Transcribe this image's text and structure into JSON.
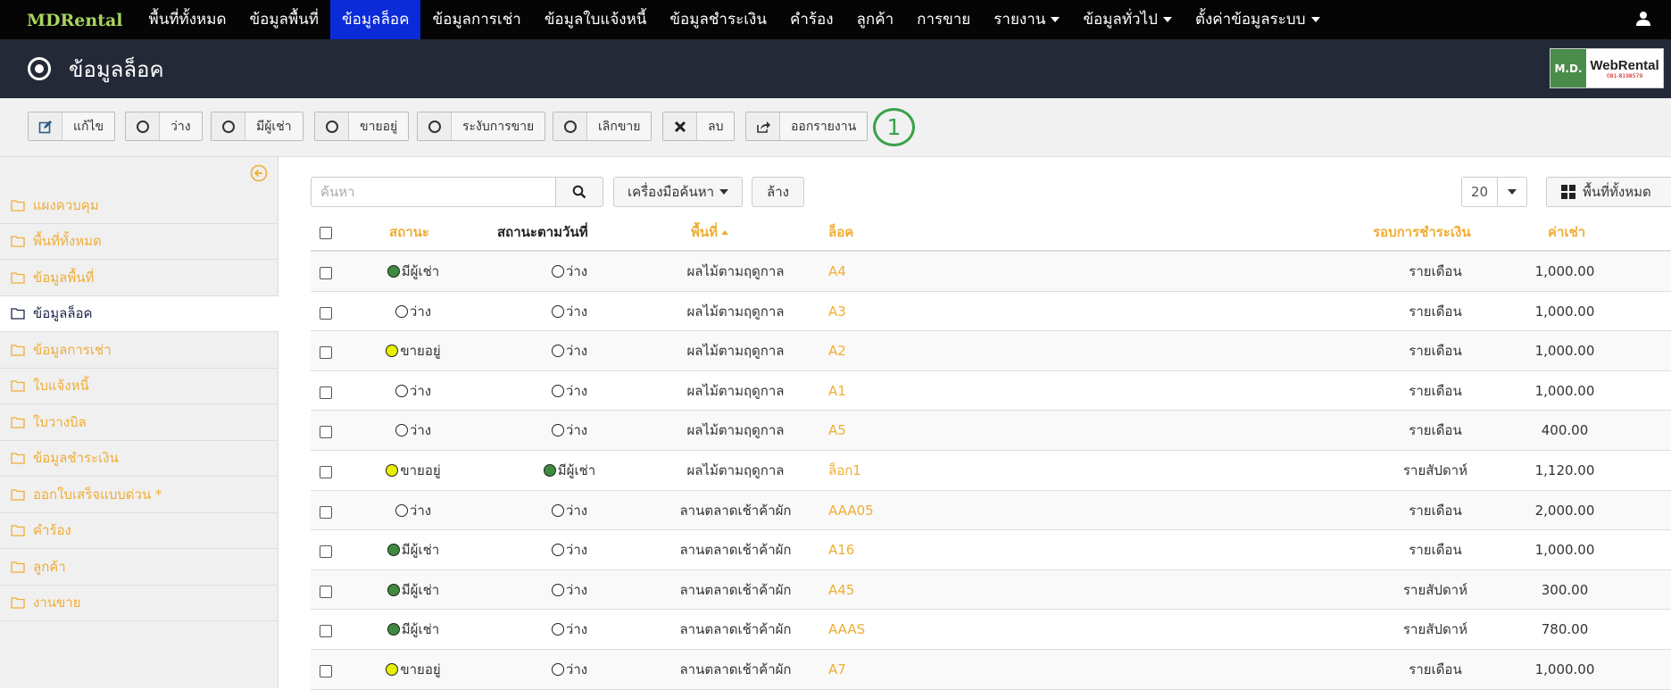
{
  "nav": {
    "brand": "MDRental",
    "items": [
      {
        "label": "พื้นที่ทั้งหมด",
        "dropdown": false,
        "active": false
      },
      {
        "label": "ข้อมูลพื้นที่",
        "dropdown": false,
        "active": false
      },
      {
        "label": "ข้อมูลล็อค",
        "dropdown": false,
        "active": true
      },
      {
        "label": "ข้อมูลการเช่า",
        "dropdown": false,
        "active": false
      },
      {
        "label": "ข้อมูลใบแจ้งหนี้",
        "dropdown": false,
        "active": false
      },
      {
        "label": "ข้อมูลชำระเงิน",
        "dropdown": false,
        "active": false
      },
      {
        "label": "คำร้อง",
        "dropdown": false,
        "active": false
      },
      {
        "label": "ลูกค้า",
        "dropdown": false,
        "active": false
      },
      {
        "label": "การขาย",
        "dropdown": false,
        "active": false
      },
      {
        "label": "รายงาน",
        "dropdown": true,
        "active": false
      },
      {
        "label": "ข้อมูลทั่วไป",
        "dropdown": true,
        "active": false
      },
      {
        "label": "ตั้งค่าข้อมูลระบบ",
        "dropdown": true,
        "active": false
      }
    ]
  },
  "header": {
    "title": "ข้อมูลล็อค",
    "logo": {
      "left": "M.D.",
      "right": "WebRental",
      "phone": "081-8198579"
    }
  },
  "toolbar": {
    "edit": "แก้ไข",
    "vacant": "ว่าง",
    "rented": "มีผู้เช่า",
    "for_sale": "ขายอยู่",
    "suspend_sale": "ระงับการขาย",
    "stop_sale": "เลิกขาย",
    "delete": "ลบ",
    "export": "ออกรายงาน",
    "step_number": "1"
  },
  "sidebar": {
    "items": [
      {
        "label": "แผงควบคุม",
        "active": false
      },
      {
        "label": "พื้นที่ทั้งหมด",
        "active": false
      },
      {
        "label": "ข้อมูลพื้นที่",
        "active": false
      },
      {
        "label": "ข้อมูลล็อค",
        "active": true
      },
      {
        "label": "ข้อมูลการเช่า",
        "active": false
      },
      {
        "label": "ใบแจ้งหนี้",
        "active": false
      },
      {
        "label": "ใบวางบิล",
        "active": false
      },
      {
        "label": "ข้อมูลชำระเงิน",
        "active": false
      },
      {
        "label": "ออกใบเสร็จแบบด่วน *",
        "active": false
      },
      {
        "label": "คำร้อง",
        "active": false
      },
      {
        "label": "ลูกค้า",
        "active": false
      },
      {
        "label": "งานขาย",
        "active": false
      }
    ]
  },
  "search": {
    "placeholder": "ค้นหา",
    "tools_label": "เครื่องมือค้นหา",
    "clear_label": "ล้าง",
    "page_size": "20",
    "view_label": "พื้นที่ทั้งหมด"
  },
  "table": {
    "headers": {
      "status": "สถานะ",
      "status_by_date": "สถานะตามวันที่",
      "area": "พื้นที่",
      "lock": "ล็อค",
      "payment_cycle": "รอบการชำระเงิน",
      "rent": "ค่าเช่า"
    },
    "status_colors": {
      "มีผู้เช่า": "#3e8a3e",
      "ขายอยู่": "#e6f000",
      "ว่าง": "#ffffff"
    },
    "rows": [
      {
        "status": "มีผู้เช่า",
        "date_status": "ว่าง",
        "area": "ผลไม้ตามฤดูกาล",
        "lock": "A4",
        "cycle": "รายเดือน",
        "rent": "1,000.00"
      },
      {
        "status": "ว่าง",
        "date_status": "ว่าง",
        "area": "ผลไม้ตามฤดูกาล",
        "lock": "A3",
        "cycle": "รายเดือน",
        "rent": "1,000.00"
      },
      {
        "status": "ขายอยู่",
        "date_status": "ว่าง",
        "area": "ผลไม้ตามฤดูกาล",
        "lock": "A2",
        "cycle": "รายเดือน",
        "rent": "1,000.00"
      },
      {
        "status": "ว่าง",
        "date_status": "ว่าง",
        "area": "ผลไม้ตามฤดูกาล",
        "lock": "A1",
        "cycle": "รายเดือน",
        "rent": "1,000.00"
      },
      {
        "status": "ว่าง",
        "date_status": "ว่าง",
        "area": "ผลไม้ตามฤดูกาล",
        "lock": "A5",
        "cycle": "รายเดือน",
        "rent": "400.00"
      },
      {
        "status": "ขายอยู่",
        "date_status": "มีผู้เช่า",
        "area": "ผลไม้ตามฤดูกาล",
        "lock": "ล็อก1",
        "cycle": "รายสัปดาห์",
        "rent": "1,120.00"
      },
      {
        "status": "ว่าง",
        "date_status": "ว่าง",
        "area": "ลานตลาดเช้าค้าผัก",
        "lock": "AAA05",
        "cycle": "รายเดือน",
        "rent": "2,000.00"
      },
      {
        "status": "มีผู้เช่า",
        "date_status": "ว่าง",
        "area": "ลานตลาดเช้าค้าผัก",
        "lock": "A16",
        "cycle": "รายเดือน",
        "rent": "1,000.00"
      },
      {
        "status": "มีผู้เช่า",
        "date_status": "ว่าง",
        "area": "ลานตลาดเช้าค้าผัก",
        "lock": "A45",
        "cycle": "รายสัปดาห์",
        "rent": "300.00"
      },
      {
        "status": "มีผู้เช่า",
        "date_status": "ว่าง",
        "area": "ลานตลาดเช้าค้าผัก",
        "lock": "AAAS",
        "cycle": "รายสัปดาห์",
        "rent": "780.00"
      },
      {
        "status": "ขายอยู่",
        "date_status": "ว่าง",
        "area": "ลานตลาดเช้าค้าผัก",
        "lock": "A7",
        "cycle": "รายเดือน",
        "rent": "1,000.00"
      }
    ]
  }
}
